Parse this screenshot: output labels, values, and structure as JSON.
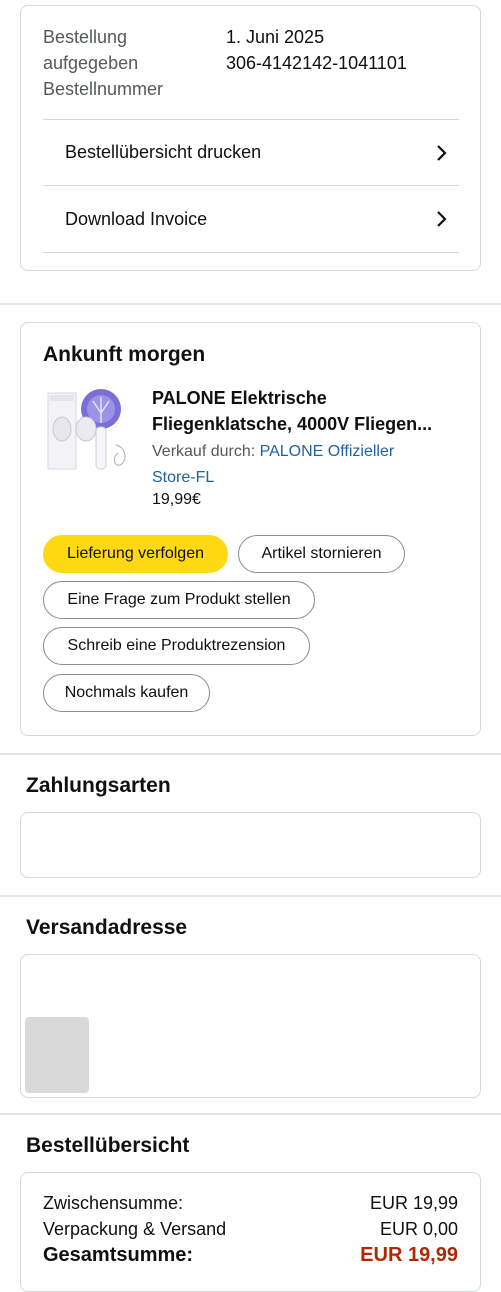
{
  "order": {
    "labels": [
      "Bestellung",
      "aufgegeben",
      "Bestellnummer"
    ],
    "date": "1. Juni 2025",
    "number": "306-4142142-1041101",
    "links": [
      "Bestellübersicht drucken",
      "Download Invoice"
    ]
  },
  "arrival": {
    "heading": "Ankunft morgen",
    "product": {
      "title_line1": "PALONE Elektrische",
      "title_line2": "Fliegenklatsche, 4000V Fliegen...",
      "seller_prefix": "Verkauf durch: ",
      "seller_name_line1": "PALONE Offizieller",
      "seller_name_line2": "Store-FL",
      "price": "19,99€"
    },
    "buttons": {
      "track": "Lieferung verfolgen",
      "cancel": "Artikel stornieren",
      "question": "Eine Frage zum Produkt stellen",
      "review": "Schreib eine Produktrezension",
      "buy_again": "Nochmals kaufen"
    }
  },
  "payment": {
    "heading": "Zahlungsarten"
  },
  "shipping": {
    "heading": "Versandadresse"
  },
  "summary": {
    "heading": "Bestellübersicht",
    "subtotal_label": "Zwischensumme:",
    "subtotal_value": "EUR 19,99",
    "shipping_label": "Verpackung & Versand",
    "shipping_value": "EUR 0,00",
    "total_label": "Gesamtsumme:",
    "total_value": "EUR 19,99"
  },
  "colors": {
    "primary_button": "#ffd814",
    "link": "#2162a1",
    "total_price": "#b12704"
  },
  "icons": {
    "link_arrow": "chevron-right-icon"
  }
}
